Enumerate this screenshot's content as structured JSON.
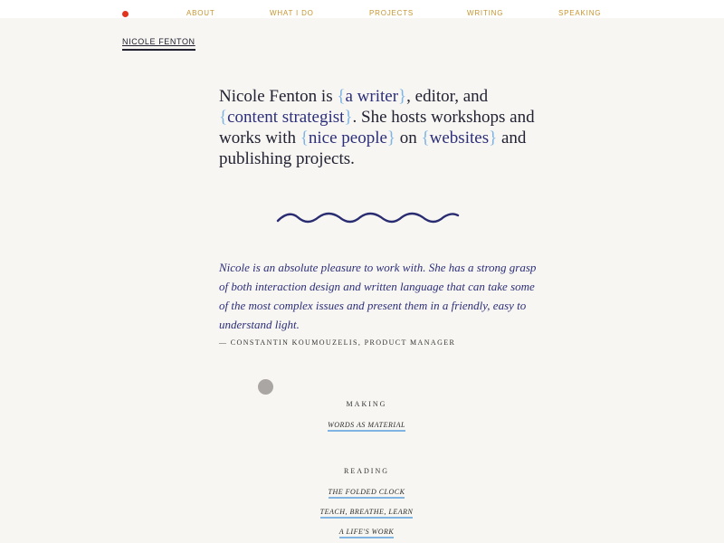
{
  "nav": {
    "items": [
      "ABOUT",
      "WHAT I DO",
      "PROJECTS",
      "WRITING",
      "SPEAKING"
    ]
  },
  "brand": "NICOLE FENTON",
  "intro": {
    "text_1": "Nicole Fenton is ",
    "link_1": "a writer",
    "text_2": ", editor, and ",
    "link_2": "content strategist",
    "text_3": ". She hosts workshops and works with ",
    "link_3": "nice people",
    "text_4": " on ",
    "link_4": "websites",
    "text_5": " and publishing projects.",
    "open_brace": "{",
    "close_brace": "}"
  },
  "testimonial": {
    "quote": "Nicole is an absolute pleasure to work with. She has a strong grasp of both interaction design and written language that can take some of the most complex issues and present them in a friendly, easy to understand light.",
    "cite": "— CONSTANTIN KOUMOUZELIS, PRODUCT MANAGER"
  },
  "making": {
    "heading": "MAKING",
    "links": [
      "WORDS AS MATERIAL"
    ]
  },
  "reading": {
    "heading": "READING",
    "links": [
      "THE FOLDED CLOCK",
      "TEACH, BREATHE, LEARN",
      "A LIFE'S WORK"
    ]
  },
  "colors": {
    "background": "#f7f6f2",
    "accent_red": "#e2331c",
    "nav_gold": "#c6952f",
    "link_navy": "#2d2f7a",
    "brace_blue": "#7fb4e3"
  }
}
